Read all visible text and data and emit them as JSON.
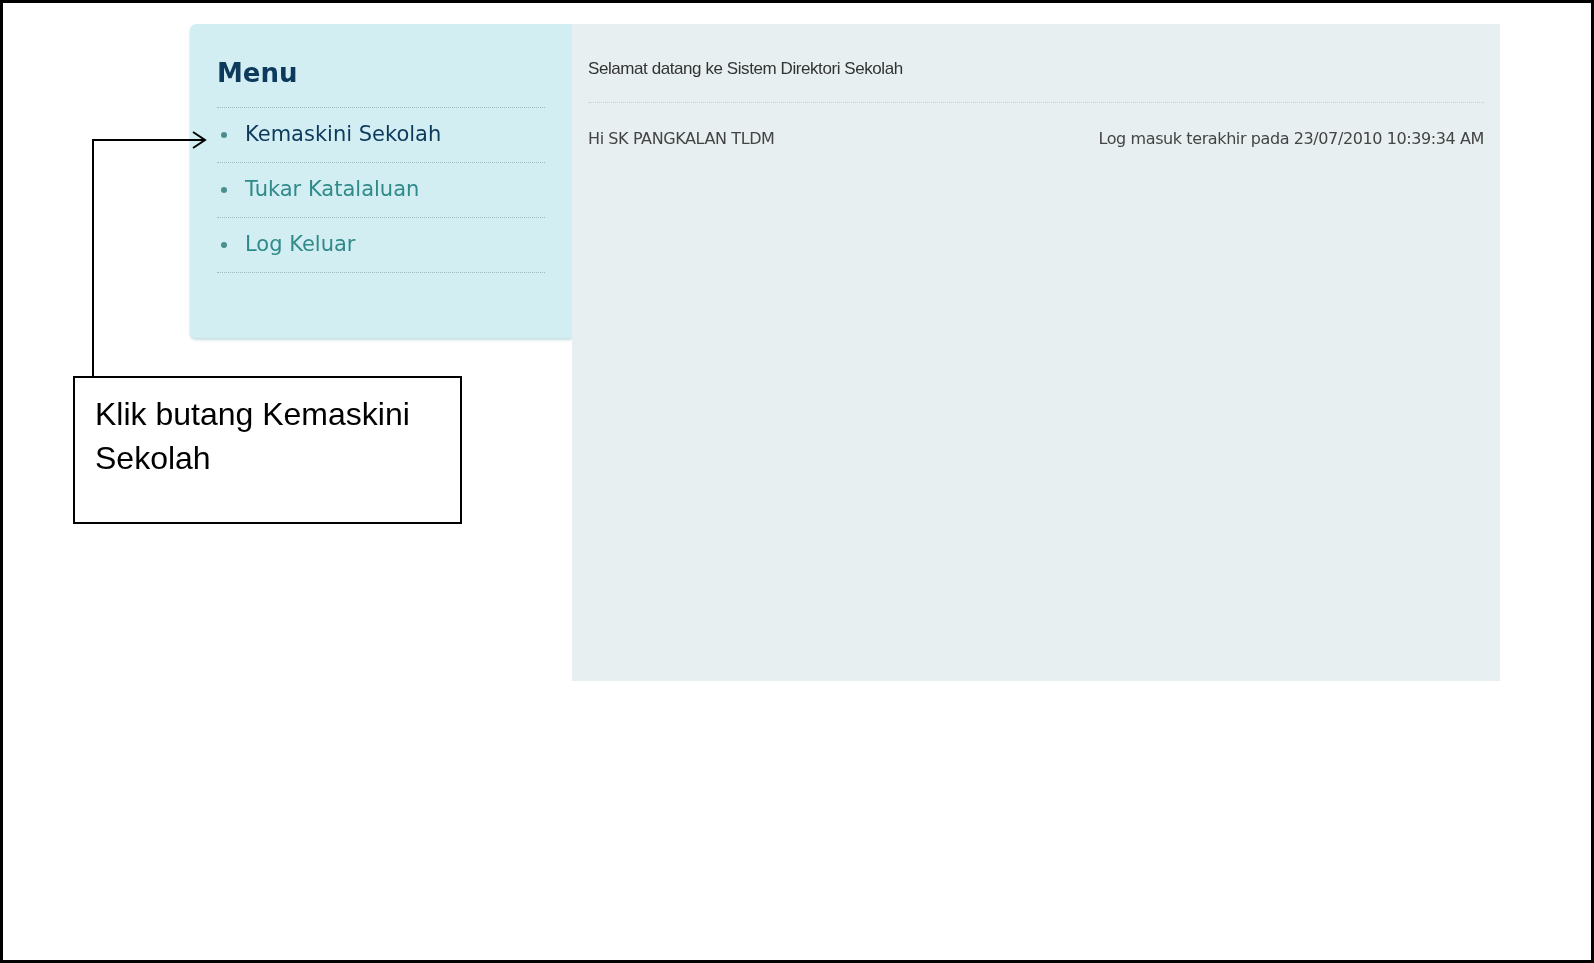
{
  "menu": {
    "title": "Menu",
    "items": [
      {
        "label": "Kemaskini Sekolah",
        "selected": true
      },
      {
        "label": "Tukar Katalaluan",
        "selected": false
      },
      {
        "label": "Log Keluar",
        "selected": false
      }
    ]
  },
  "content": {
    "heading": "Selamat datang ke Sistem Direktori Sekolah",
    "greeting": "Hi SK PANGKALAN TLDM",
    "last_login": "Log masuk terakhir pada 23/07/2010 10:39:34 AM"
  },
  "callout": {
    "text": "Klik butang Kemaskini Sekolah"
  }
}
